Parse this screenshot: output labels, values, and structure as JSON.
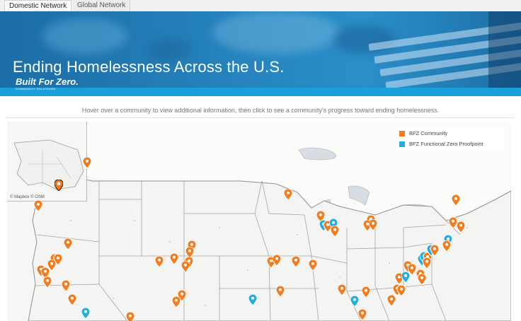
{
  "tabs": [
    {
      "label": "Domestic Network",
      "active": true
    },
    {
      "label": "Global Network",
      "active": false
    }
  ],
  "hero": {
    "title": "Ending Homelessness Across the U.S.",
    "brand_name": "Built For Zero.",
    "brand_sub": "COMMUNITY SOLUTIONS"
  },
  "instructions": "Hover over a community to view additional information, then click to see a community's progress toward ending homelessness.",
  "map": {
    "attribution": "© Mapbox © OSM",
    "legend": [
      {
        "label": "BFZ Community",
        "color": "#f47c20",
        "icon": "orange-square-icon"
      },
      {
        "label": "BFZ Functional Zero Proofpoint",
        "color": "#23aee0",
        "icon": "blue-square-icon"
      }
    ],
    "colors": {
      "community": "#f47c20",
      "proofpoint": "#23aee0",
      "land": "#f6f6f4",
      "border": "#9a9a9a"
    }
  }
}
